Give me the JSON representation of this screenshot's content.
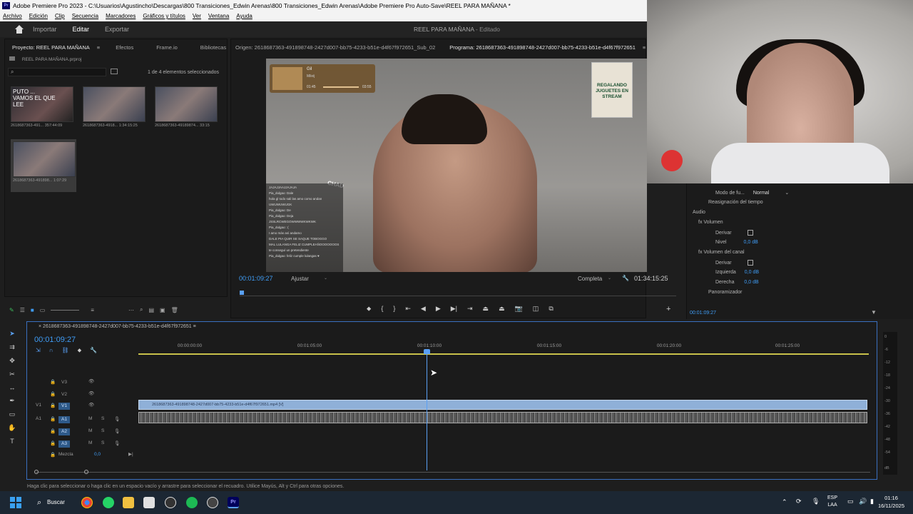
{
  "window": {
    "title": "Adobe Premiere Pro 2023 - C:\\Usuarios\\Agustincho\\Descargas\\800 Transiciones_Edwin Arenas\\800 Transiciones_Edwin Arenas\\Adobe Premiere Pro Auto-Save\\REEL PARA MAÑANA *",
    "app_badge": "Pr"
  },
  "menu": [
    "Archivo",
    "Edición",
    "Clip",
    "Secuencia",
    "Marcadores",
    "Gráficos y títulos",
    "Ver",
    "Ventana",
    "Ayuda"
  ],
  "header": {
    "tabs": [
      "Importar",
      "Editar",
      "Exportar"
    ],
    "active_tab": "Editar",
    "doc_name": "REEL PARA MAÑANA",
    "doc_state": "- Editado"
  },
  "project": {
    "tabs": [
      "Proyecto: REEL PARA MAÑANA",
      "Efectos",
      "Frame.io",
      "Bibliotecas"
    ],
    "file": "REEL PARA MAÑANA.prproj",
    "selection_info": "1 de 4 elementos seleccionados",
    "items": [
      {
        "name": "2618687363-491...",
        "duration": "357:44:09",
        "overlay": "PUTO ... VAMOS EL QUE LEE"
      },
      {
        "name": "2618687363-4918...",
        "duration": "1:34:15:25",
        "overlay": ""
      },
      {
        "name": "2618687363-49189874...",
        "duration": "33:15",
        "overlay": ""
      },
      {
        "name": "2618687363-491898...",
        "duration": "1:07:29",
        "overlay": ""
      }
    ]
  },
  "monitor": {
    "source_tab": "Origen: 2618687363-491898748-2427d007-bb75-4233-b51e-d4f67f972651_Sub_02",
    "program_tab": "Programa: 2618687363-491898748-2427d007-bb75-4233-b51e-d4f67f972651",
    "current_time": "00:01:09:27",
    "fit": "Ajustar",
    "quality": "Completa",
    "duration": "01:34:15:25",
    "overlay_music_title": "Gil",
    "overlay_music_artist": "Mileij",
    "overlay_music_elapsed": "01:45",
    "overlay_music_total": "03:55",
    "poster_text": "REGALANDO JUGUETES EN STREAM",
    "chad_label": "CHAD",
    "chat_lines": [
      "JAJAJJAAJJAJAJA",
      "Pia_dulgao: Dale",
      "hola gl todo sali las amo como andan",
      "UWUWUWUGK",
      "Pia_dulgao: De",
      "Pia_dulgao: Deja",
      "JSSLRCWEGOWWWWKWKWK",
      "Pia_dulgao: :(",
      "I amo más así andamo",
      "DALE PIA QUIR SE SAQUE TOBOGGO",
      "MAL LULANGA FELIZ CUMPLEAÑOOOOOOOS",
      "te conseguí un pretendiente",
      "Pia_dulgao: feliz cumple lulangas ♥"
    ]
  },
  "effects": {
    "mode_label": "Modo de fu...",
    "mode_value": "Normal",
    "time_remap": "Reasignación del tiempo",
    "audio_section": "Audio",
    "rows": [
      {
        "label": "Volumen",
        "value": ""
      },
      {
        "label": "Derivar",
        "value": ""
      },
      {
        "label": "Nivel",
        "value": "0,0 dB"
      },
      {
        "label": "Volumen del canal",
        "value": ""
      },
      {
        "label": "Derivar",
        "value": ""
      },
      {
        "label": "Izquierda",
        "value": "0,0 dB"
      },
      {
        "label": "Derecha",
        "value": "0,0 dB"
      },
      {
        "label": "Panoramizador",
        "value": ""
      }
    ],
    "current_time": "00:01:09:27"
  },
  "timeline": {
    "sequence_tab": "2618687363-491898748-2427d007-bb75-4233-b51e-d4f67f972651",
    "current_time": "00:01:09:27",
    "ruler": [
      "00:00:00:00",
      "00:01:05:00",
      "00:01:10:00",
      "00:01:15:00",
      "00:01:20:00",
      "00:01:25:00"
    ],
    "tracks_video": [
      "V3",
      "V2",
      "V1"
    ],
    "tracks_audio": [
      "A1",
      "A2",
      "A3"
    ],
    "v1_source_label": "V1",
    "a1_source_label": "A1",
    "mix_label": "Mezcla",
    "mix_value": "0,0",
    "clip_label": "2618687363-491898748-2427d007-bb75-4233-b51e-d4f67f972651.mp4 [V]"
  },
  "vu_meter": [
    "0",
    "-6",
    "-12",
    "-18",
    "-24",
    "-30",
    "-36",
    "-42",
    "-48",
    "-54",
    "dB"
  ],
  "statusbar": "Haga clic para seleccionar o haga clic en un espacio vacío y arrastre para seleccionar el recuadro. Utilice Mayús, Alt y Ctrl para otras opciones.",
  "taskbar": {
    "search": "Buscar",
    "lang_top": "ESP",
    "lang_bottom": "LAA",
    "time": "01:16",
    "date": "16/11/2025"
  }
}
